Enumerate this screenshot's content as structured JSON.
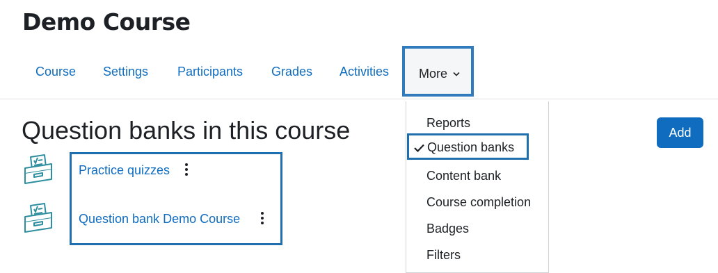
{
  "course": {
    "title": "Demo Course"
  },
  "nav": {
    "items": [
      "Course",
      "Settings",
      "Participants",
      "Grades",
      "Activities"
    ],
    "more_label": "More"
  },
  "page": {
    "heading": "Question banks in this course",
    "add_label": "Add"
  },
  "banks": [
    {
      "name": "Practice quizzes"
    },
    {
      "name": "Question bank Demo Course"
    }
  ],
  "more_menu": {
    "items": [
      "Reports",
      "Question banks",
      "Content bank",
      "Course completion",
      "Badges",
      "Filters"
    ],
    "active": "Question banks"
  },
  "colors": {
    "link": "#0f6cbf",
    "primary_button": "#0f6cbf",
    "highlight_border": "#1f6ead",
    "icon_teal": "#2c8e9f"
  }
}
